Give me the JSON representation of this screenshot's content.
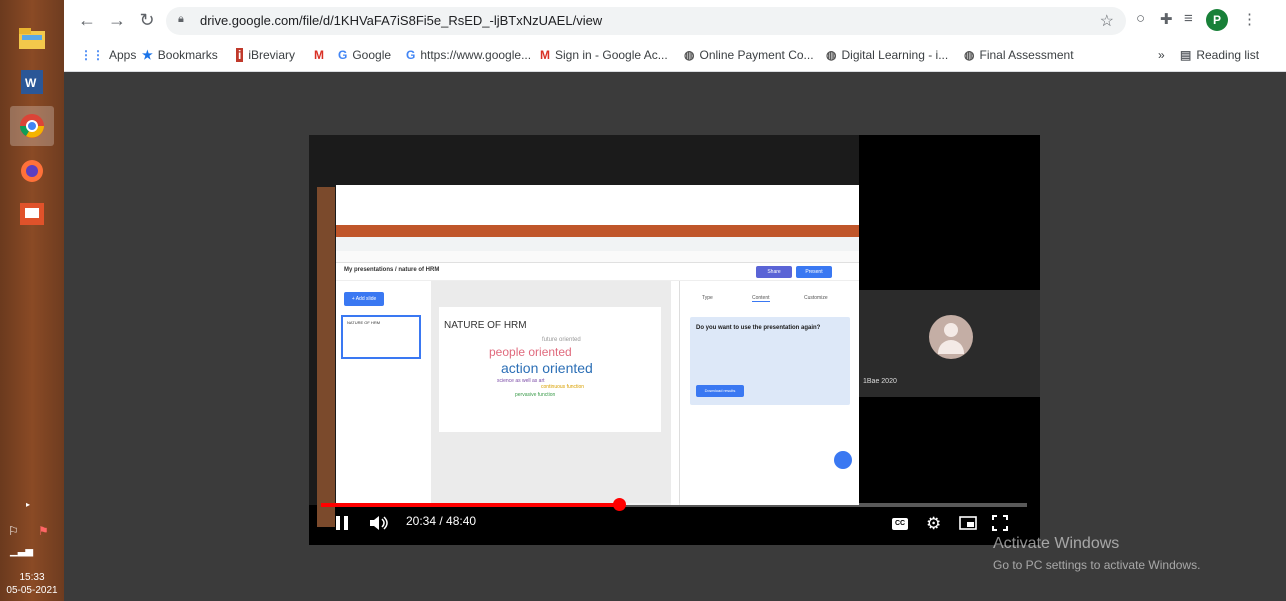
{
  "browser": {
    "url": "drive.google.com/file/d/1KHVaFA7iS8Fi5e_RsED_-ljBTxNzUAEL/view",
    "profile_initial": "P",
    "bookmarks": [
      {
        "label": "Apps",
        "icon": "apps-grid-icon"
      },
      {
        "label": "Bookmarks",
        "icon": "star-icon"
      },
      {
        "label": "iBreviary",
        "icon": "ibreviary-icon"
      },
      {
        "label": "",
        "icon": "gmail-icon"
      },
      {
        "label": "Google",
        "icon": "google-icon"
      },
      {
        "label": "https://www.google...",
        "icon": "google-icon"
      },
      {
        "label": "Sign in - Google Ac...",
        "icon": "gmail-icon"
      },
      {
        "label": "Online Payment Co...",
        "icon": "globe-icon"
      },
      {
        "label": "Digital Learning - i...",
        "icon": "globe-icon"
      },
      {
        "label": "Final Assessment",
        "icon": "globe-icon"
      }
    ],
    "overflow_label": "»",
    "reading_list": "Reading list"
  },
  "video": {
    "time_display": "20:34 / 48:40",
    "progress_fraction": 0.4226,
    "participant_name": "1Bae 2020"
  },
  "slide": {
    "title": "NATURE OF HRM",
    "thumb_label": "NATURE OF HRM",
    "breadcrumb": "My presentations / nature of HRM",
    "words": [
      "future oriented",
      "people oriented",
      "action oriented",
      "science as well as art",
      "continuous function",
      "pervasive function"
    ],
    "share_label": "Share",
    "present_label": "Present",
    "add_slide_label": "+ Add slide",
    "panel_tabs": [
      "Type",
      "Content",
      "Customize"
    ],
    "panel_box_title": "Do you want to use the presentation again?",
    "panel_download_label": "Download results"
  },
  "windows": {
    "activate_title": "Activate Windows",
    "activate_sub": "Go to PC settings to activate Windows."
  },
  "taskbar": {
    "time": "15:33",
    "date": "05-05-2021"
  }
}
